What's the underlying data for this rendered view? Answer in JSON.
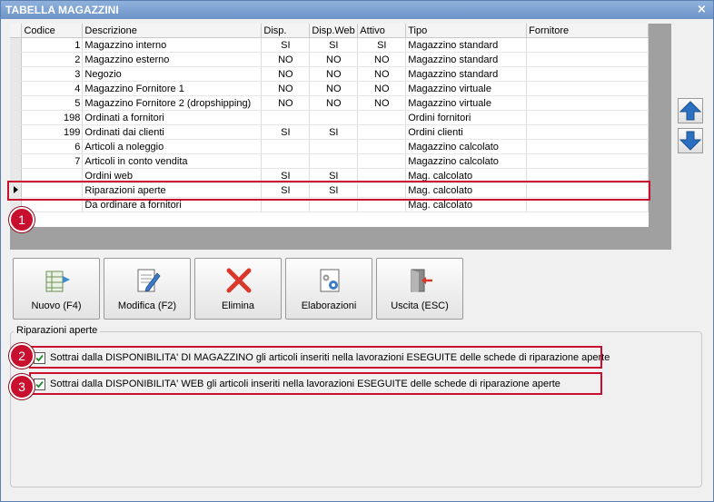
{
  "window": {
    "title": "TABELLA MAGAZZINI",
    "close_glyph": "×"
  },
  "grid": {
    "columns": [
      "Codice",
      "Descrizione",
      "Disp.",
      "Disp.Web",
      "Attivo",
      "Tipo",
      "Fornitore"
    ],
    "rows": [
      {
        "codice": "1",
        "descrizione": "Magazzino interno",
        "disp": "SI",
        "disp_web": "SI",
        "attivo": "SI",
        "tipo": "Magazzino standard",
        "fornitore": ""
      },
      {
        "codice": "2",
        "descrizione": "Magazzino esterno",
        "disp": "NO",
        "disp_web": "NO",
        "attivo": "NO",
        "tipo": "Magazzino standard",
        "fornitore": ""
      },
      {
        "codice": "3",
        "descrizione": "Negozio",
        "disp": "NO",
        "disp_web": "NO",
        "attivo": "NO",
        "tipo": "Magazzino standard",
        "fornitore": ""
      },
      {
        "codice": "4",
        "descrizione": "Magazzino Fornitore 1",
        "disp": "NO",
        "disp_web": "NO",
        "attivo": "NO",
        "tipo": "Magazzino virtuale",
        "fornitore": ""
      },
      {
        "codice": "5",
        "descrizione": "Magazzino Fornitore 2 (dropshipping)",
        "disp": "NO",
        "disp_web": "NO",
        "attivo": "NO",
        "tipo": "Magazzino virtuale",
        "fornitore": ""
      },
      {
        "codice": "198",
        "descrizione": "Ordinati a fornitori",
        "disp": "",
        "disp_web": "",
        "attivo": "",
        "tipo": "Ordini fornitori",
        "fornitore": ""
      },
      {
        "codice": "199",
        "descrizione": "Ordinati dai clienti",
        "disp": "SI",
        "disp_web": "SI",
        "attivo": "",
        "tipo": "Ordini clienti",
        "fornitore": ""
      },
      {
        "codice": "6",
        "descrizione": "Articoli a noleggio",
        "disp": "",
        "disp_web": "",
        "attivo": "",
        "tipo": "Magazzino calcolato",
        "fornitore": ""
      },
      {
        "codice": "7",
        "descrizione": "Articoli in conto vendita",
        "disp": "",
        "disp_web": "",
        "attivo": "",
        "tipo": "Magazzino calcolato",
        "fornitore": ""
      },
      {
        "codice": "",
        "descrizione": "Ordini web",
        "disp": "SI",
        "disp_web": "SI",
        "attivo": "",
        "tipo": "Mag. calcolato",
        "fornitore": ""
      },
      {
        "codice": "",
        "descrizione": "Riparazioni aperte",
        "disp": "SI",
        "disp_web": "SI",
        "attivo": "",
        "tipo": "Mag. calcolato",
        "fornitore": "",
        "selected": true
      },
      {
        "codice": "",
        "descrizione": "Da ordinare a fornitori",
        "disp": "",
        "disp_web": "",
        "attivo": "",
        "tipo": "Mag. calcolato",
        "fornitore": ""
      }
    ]
  },
  "side_buttons": {
    "up_icon": "arrow-up-icon",
    "down_icon": "arrow-down-icon"
  },
  "toolbar": {
    "nuovo": "Nuovo (F4)",
    "modifica": "Modifica (F2)",
    "elimina": "Elimina",
    "elaborazioni": "Elaborazioni",
    "uscita": "Uscita (ESC)"
  },
  "group": {
    "title": "Riparazioni aperte",
    "checkbox_1": {
      "label": "Sottrai dalla DISPONIBILITA' DI MAGAZZINO gli articoli inseriti nella lavorazioni ESEGUITE delle schede di riparazione aperte",
      "checked": true
    },
    "checkbox_2": {
      "label": "Sottrai dalla DISPONIBILITA' WEB gli articoli inseriti nella lavorazioni ESEGUITE delle schede di riparazione aperte",
      "checked": true
    }
  },
  "callouts": {
    "one": "1",
    "two": "2",
    "three": "3"
  },
  "colors": {
    "highlight": "#c8102e",
    "titlebar": "#7a9fd0",
    "arrow": "#2a6fc0"
  }
}
